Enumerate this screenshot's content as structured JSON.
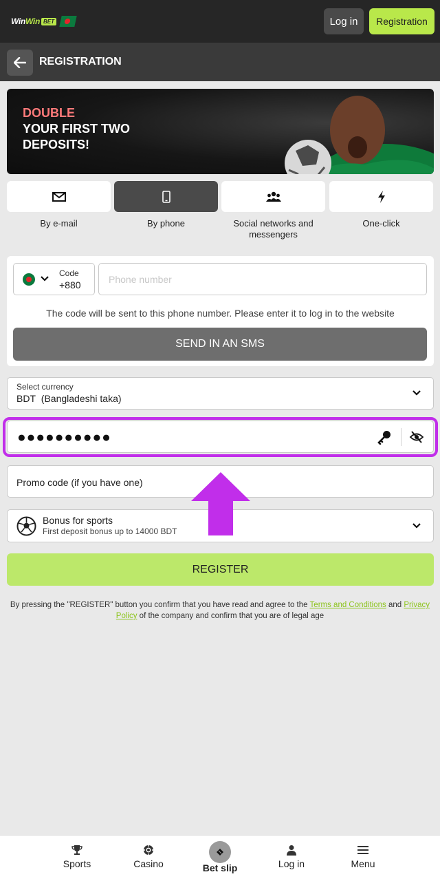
{
  "header": {
    "logo_text_a": "Win",
    "logo_text_b": "Win",
    "logo_badge": "BET",
    "login_label": "Log in",
    "registration_label": "Registration"
  },
  "subheader": {
    "title": "REGISTRATION"
  },
  "banner": {
    "line1": "DOUBLE",
    "line2": "YOUR FIRST TWO",
    "line3": "DEPOSITS!"
  },
  "methods": [
    {
      "label": "By e-mail",
      "icon": "envelope-icon",
      "active": false
    },
    {
      "label": "By phone",
      "icon": "smartphone-icon",
      "active": true
    },
    {
      "label": "Social networks and messengers",
      "icon": "users-icon",
      "active": false
    },
    {
      "label": "One-click",
      "icon": "lightning-icon",
      "active": false
    }
  ],
  "phone": {
    "code_label": "Code",
    "code_value": "+880",
    "placeholder": "Phone number",
    "hint": "The code will be sent to this phone number. Please enter it to log in to the website",
    "send_button": "SEND IN AN SMS"
  },
  "currency": {
    "label": "Select currency",
    "code": "BDT",
    "name": "(Bangladeshi taka)"
  },
  "password": {
    "masked_value": "●●●●●●●●●●"
  },
  "promo": {
    "placeholder": "Promo code (if you have one)"
  },
  "bonus": {
    "title": "Bonus for sports",
    "subtitle": "First deposit bonus up to 14000 BDT"
  },
  "register_button": "REGISTER",
  "legal": {
    "prefix": "By pressing the \"REGISTER\" button you confirm that you have read and agree to the ",
    "terms_link": "Terms and Conditions",
    "and": " and ",
    "privacy_link_a": "Privacy",
    "privacy_link_b": "Policy",
    "suffix": " of the company and confirm that you are of legal age"
  },
  "bottom_nav": [
    {
      "label": "Sports",
      "icon": "trophy-icon"
    },
    {
      "label": "Casino",
      "icon": "casino-chip-icon"
    },
    {
      "label": "Bet slip",
      "icon": "ticket-icon"
    },
    {
      "label": "Log in",
      "icon": "user-icon"
    },
    {
      "label": "Menu",
      "icon": "hamburger-icon"
    }
  ],
  "colors": {
    "brand_green": "#b9e84a",
    "highlight_purple": "#c12eea",
    "header_dark": "#262626"
  }
}
